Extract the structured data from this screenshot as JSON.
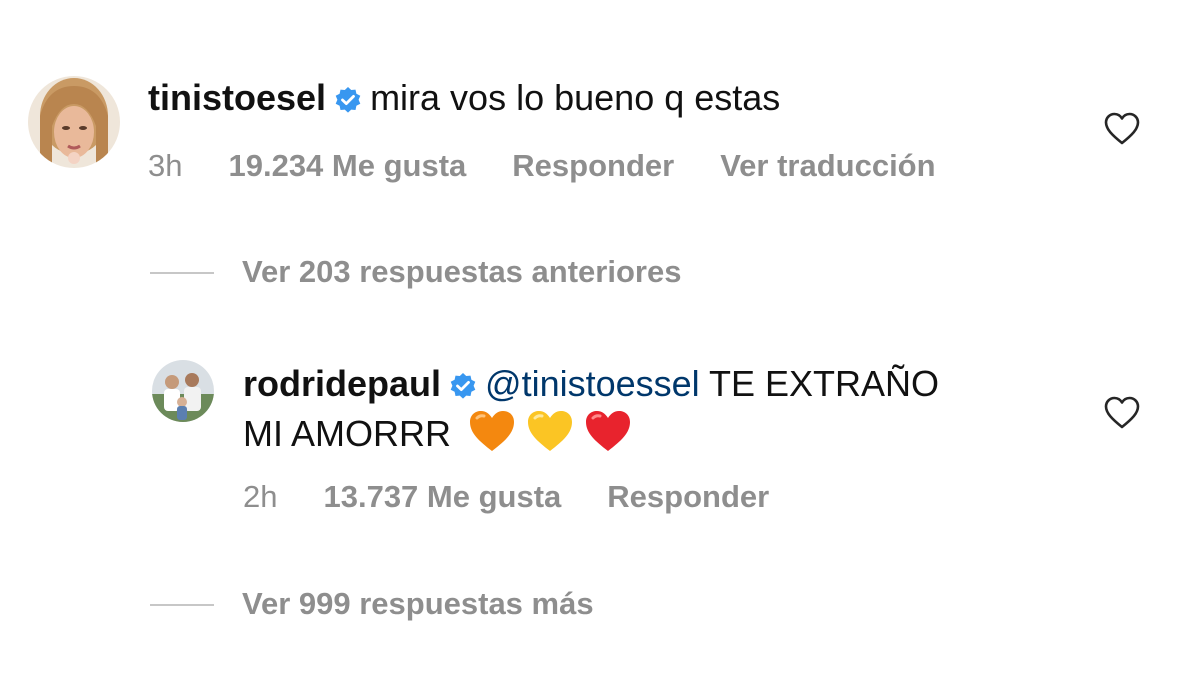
{
  "comments": [
    {
      "username": "tinistoesel",
      "verified": true,
      "text": "mira vos lo bueno q estas",
      "time": "3h",
      "likes": "19.234 Me gusta",
      "reply": "Responder",
      "translate": "Ver traducción"
    },
    {
      "username": "rodridepaul",
      "verified": true,
      "mention": "@tinistoessel",
      "text_line1": " TE EXTRAÑO",
      "text_line2": "MI AMORRR",
      "time": "2h",
      "likes": "13.737 Me gusta",
      "reply": "Responder"
    }
  ],
  "view_replies_1": "Ver 203 respuestas anteriores",
  "view_replies_2": "Ver 999 respuestas más",
  "colors": {
    "text": "#111111",
    "meta": "#8e8e8e",
    "mention": "#00376b",
    "verified": "#3897f0"
  },
  "icons": [
    "verified-badge-icon",
    "heart-outline-icon",
    "orange-heart-emoji",
    "yellow-heart-emoji",
    "red-heart-emoji"
  ]
}
